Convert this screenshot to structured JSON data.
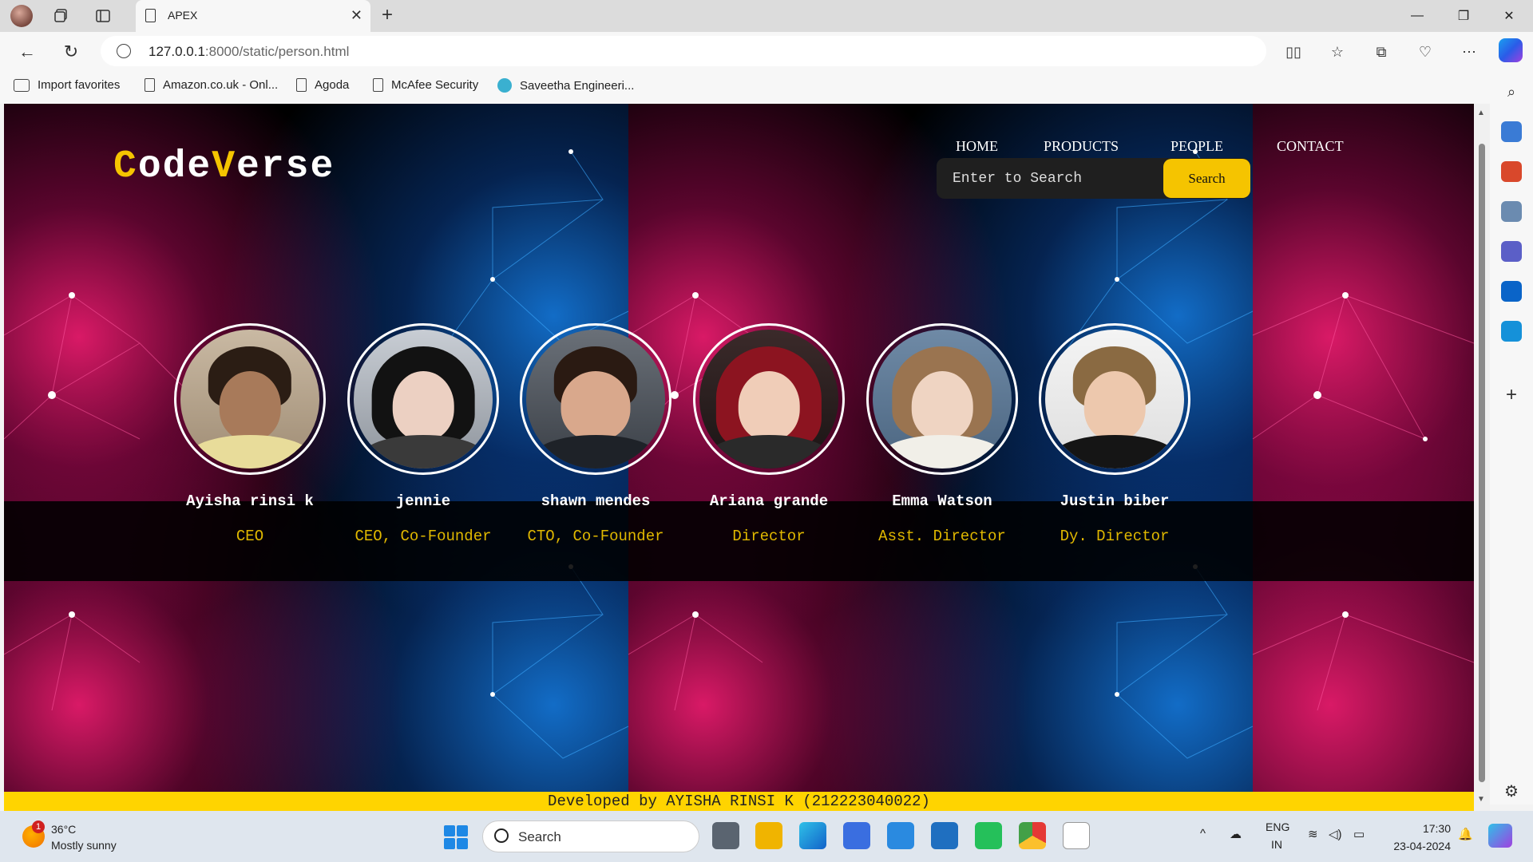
{
  "browser": {
    "tab_title": "APEX",
    "url_host": "127.0.0.1",
    "url_rest": ":8000/static/person.html",
    "favorites": [
      "Import favorites",
      "Amazon.co.uk - Onl...",
      "Agoda",
      "McAfee Security",
      "Saveetha Engineeri..."
    ]
  },
  "site": {
    "logo_c": "C",
    "logo_ode": "ode",
    "logo_v": "V",
    "logo_erse": "erse",
    "nav": [
      "HOME",
      "PRODUCTS",
      "PEOPLE",
      "CONTACT"
    ],
    "search_placeholder": "Enter to Search",
    "search_button": "Search",
    "people": [
      {
        "name": "Ayisha rinsi k",
        "role": "CEO"
      },
      {
        "name": "jennie",
        "role": "CEO, Co-Founder"
      },
      {
        "name": "shawn mendes",
        "role": "CTO, Co-Founder"
      },
      {
        "name": "Ariana grande",
        "role": "Director"
      },
      {
        "name": "Emma Watson",
        "role": "Asst. Director"
      },
      {
        "name": "Justin biber",
        "role": "Dy. Director"
      }
    ],
    "footer": "Developed by AYISHA RINSI K (212223040022)"
  },
  "taskbar": {
    "weather_badge": "1",
    "weather_temp": "36°C",
    "weather_desc": "Mostly sunny",
    "search_label": "Search",
    "lang_top": "ENG",
    "lang_bottom": "IN",
    "time": "17:30",
    "date": "23-04-2024"
  }
}
